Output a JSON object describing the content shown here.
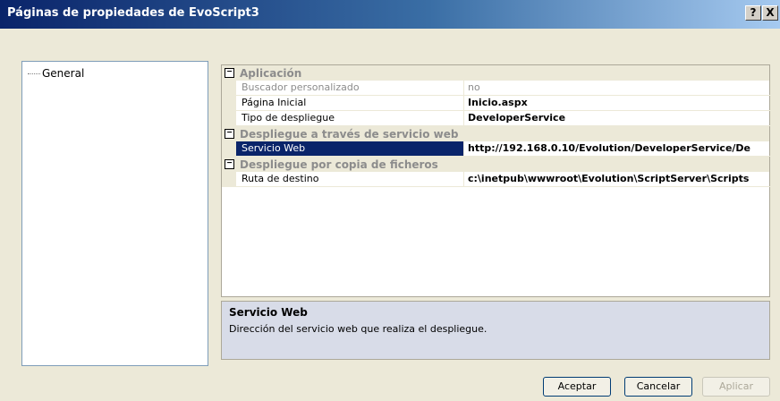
{
  "window": {
    "title": "Páginas de propiedades de EvoScript3",
    "help_label": "?",
    "close_label": "X"
  },
  "tree": {
    "items": [
      {
        "label": "General"
      }
    ]
  },
  "grid": {
    "categories": [
      {
        "label": "Aplicación",
        "expand_glyph": "−",
        "properties": [
          {
            "name": "Buscador personalizado",
            "value": "no"
          },
          {
            "name": "Página Inicial",
            "value": "Inicio.aspx"
          },
          {
            "name": "Tipo de despliegue",
            "value": "DeveloperService"
          }
        ]
      },
      {
        "label": "Despliegue a través de servicio web",
        "expand_glyph": "−",
        "properties": [
          {
            "name": "Servicio Web",
            "value": "http://192.168.0.10/Evolution/DeveloperService/De"
          }
        ]
      },
      {
        "label": "Despliegue por copia de ficheros",
        "expand_glyph": "−",
        "properties": [
          {
            "name": "Ruta de destino",
            "value": "c:\\inetpub\\wwwroot\\Evolution\\ScriptServer\\Scripts"
          }
        ]
      }
    ]
  },
  "description": {
    "title": "Servicio Web",
    "text": "Dirección del servicio web que realiza el despliegue."
  },
  "buttons": {
    "ok": "Aceptar",
    "cancel": "Cancelar",
    "apply": "Aplicar"
  },
  "colors": {
    "selection": "#0a246a",
    "category_background": "#ece9d8"
  }
}
